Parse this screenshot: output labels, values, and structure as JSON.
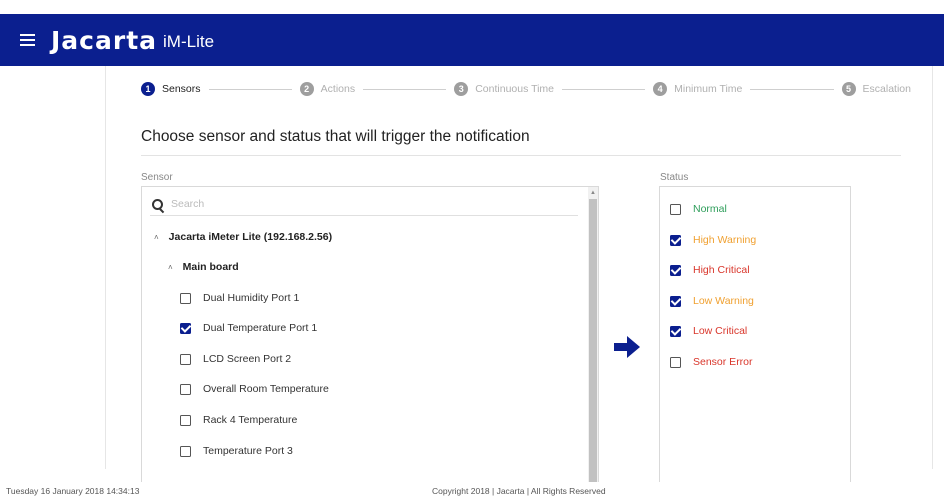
{
  "header": {
    "brand": "Jacarta",
    "product": "iM-Lite",
    "menu_icon": "hamburger-icon",
    "background_color": "#0b1f8f"
  },
  "stepper": {
    "steps": [
      {
        "number": "1",
        "label": "Sensors",
        "active": true
      },
      {
        "number": "2",
        "label": "Actions",
        "active": false
      },
      {
        "number": "3",
        "label": "Continuous Time",
        "active": false
      },
      {
        "number": "4",
        "label": "Minimum Time",
        "active": false
      },
      {
        "number": "5",
        "label": "Escalation",
        "active": false
      }
    ]
  },
  "main": {
    "heading": "Choose sensor and status that will trigger the notification"
  },
  "sensor": {
    "label": "Sensor",
    "search_placeholder": "Search",
    "search_value": "",
    "device": "Jacarta iMeter Lite (192.168.2.56)",
    "group": "Main board",
    "items": [
      {
        "label": "Dual Humidity Port 1",
        "checked": false
      },
      {
        "label": "Dual Temperature Port 1",
        "checked": true
      },
      {
        "label": "LCD Screen Port 2",
        "checked": false
      },
      {
        "label": "Overall Room Temperature",
        "checked": false
      },
      {
        "label": "Rack 4 Temperature",
        "checked": false
      },
      {
        "label": "Temperature Port 3",
        "checked": false
      }
    ]
  },
  "status": {
    "label": "Status",
    "items": [
      {
        "label": "Normal",
        "checked": false,
        "color": "#2e9e5b"
      },
      {
        "label": "High Warning",
        "checked": true,
        "color": "#f0a030"
      },
      {
        "label": "High Critical",
        "checked": true,
        "color": "#d9362b"
      },
      {
        "label": "Low Warning",
        "checked": true,
        "color": "#f0a030"
      },
      {
        "label": "Low Critical",
        "checked": true,
        "color": "#d9362b"
      },
      {
        "label": "Sensor Error",
        "checked": false,
        "color": "#d9362b"
      }
    ]
  },
  "footer": {
    "datetime": "Tuesday 16 January 2018 14:34:13",
    "copyright": "Copyright 2018 | Jacarta | All Rights Reserved"
  }
}
